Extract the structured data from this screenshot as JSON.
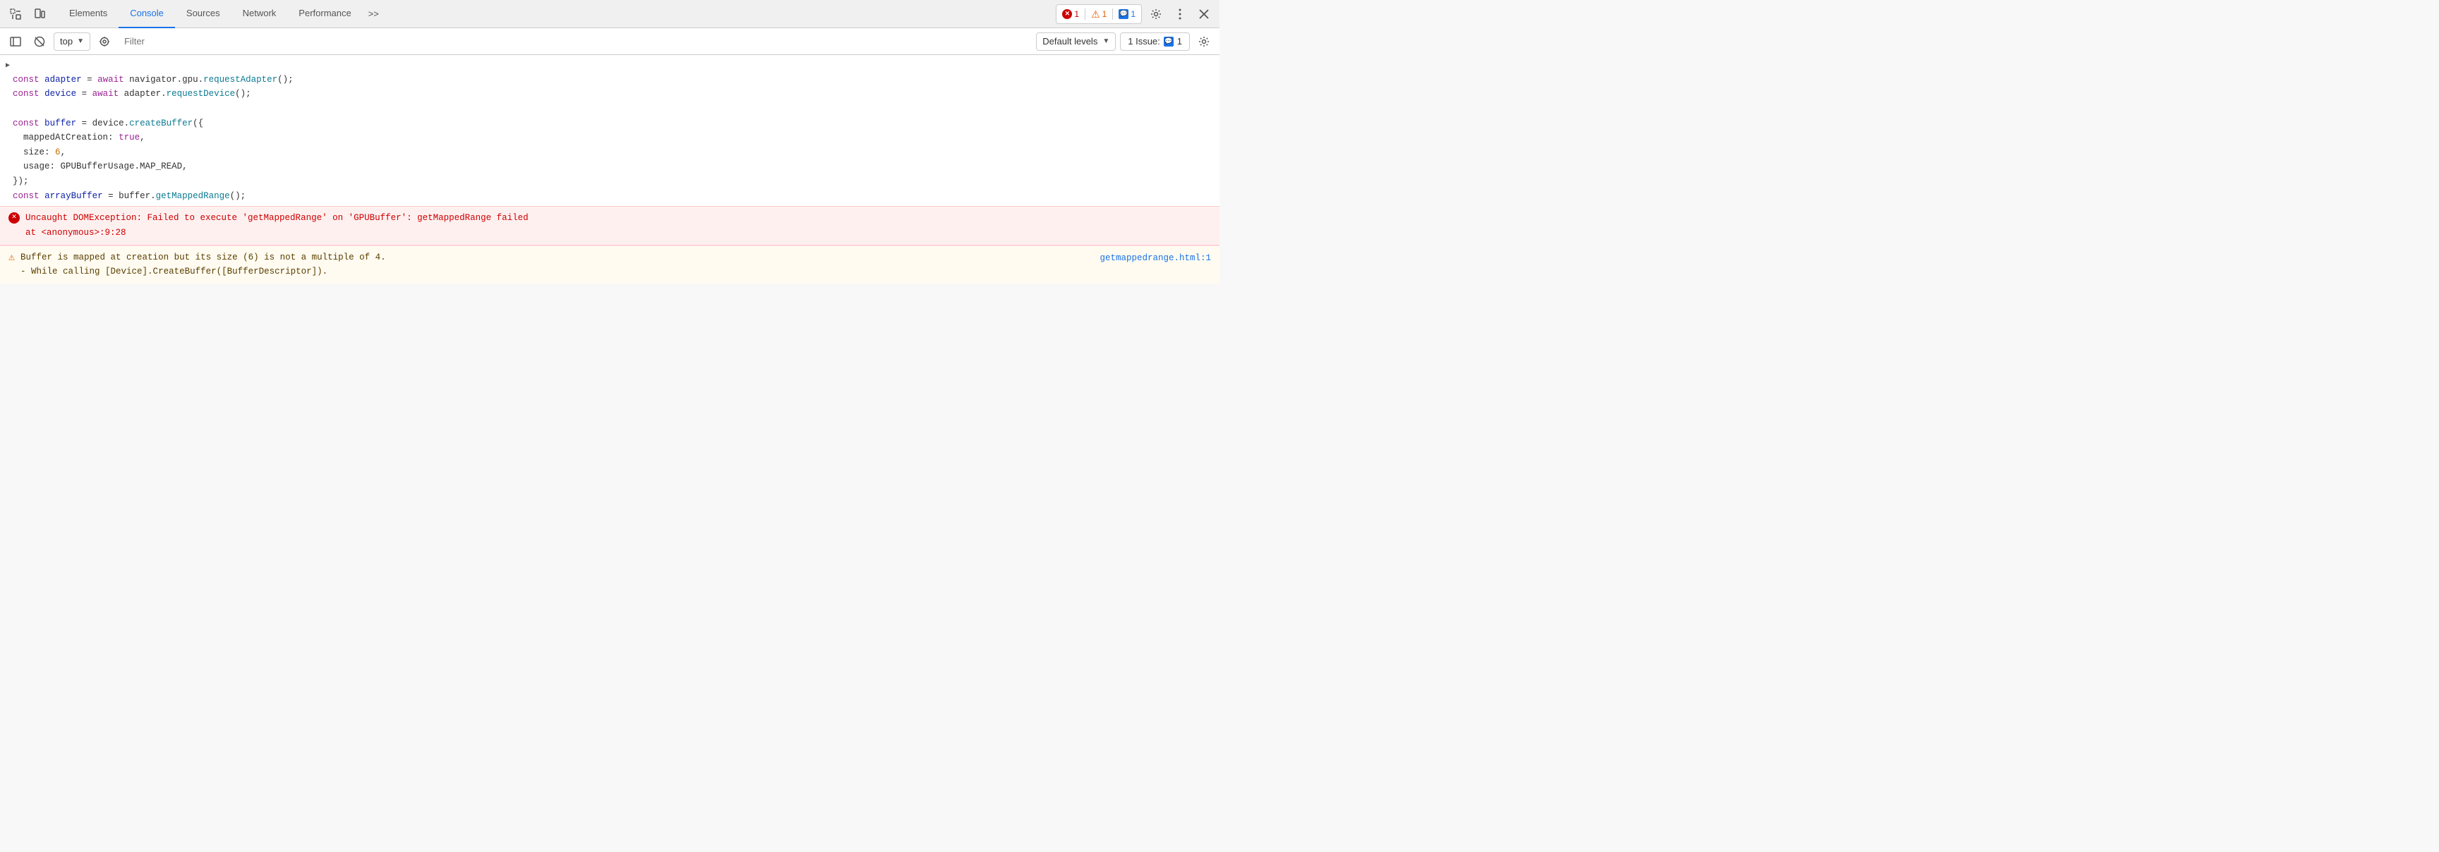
{
  "topbar": {
    "icons": {
      "inspect_label": "Inspect Element",
      "device_label": "Device Toolbar"
    },
    "tabs": [
      {
        "id": "elements",
        "label": "Elements",
        "active": false
      },
      {
        "id": "console",
        "label": "Console",
        "active": true
      },
      {
        "id": "sources",
        "label": "Sources",
        "active": false
      },
      {
        "id": "network",
        "label": "Network",
        "active": false
      },
      {
        "id": "performance",
        "label": "Performance",
        "active": false
      }
    ],
    "more_label": ">>",
    "error_count": "1",
    "warn_count": "1",
    "info_count": "1",
    "settings_label": "Settings",
    "more_options_label": "More options",
    "close_label": "Close"
  },
  "secondbar": {
    "sidebar_label": "Show sidebar",
    "clear_label": "Clear console",
    "top_selector": "top",
    "filter_placeholder": "Filter",
    "eye_label": "Live expressions",
    "default_levels_label": "Default levels",
    "issue_label": "1 Issue:",
    "issue_count": "1",
    "settings2_label": "Console settings"
  },
  "console": {
    "code_line1": "> const adapter = await navigator.gpu.requestAdapter();",
    "code_line2": "  const device = await adapter.requestDevice();",
    "code_line3": "",
    "code_line4": "  const buffer = device.createBuffer({",
    "code_line5": "    mappedAtCreation: true,",
    "code_line6": "    size: 6,",
    "code_line7": "    usage: GPUBufferUsage.MAP_READ,",
    "code_line8": "  });",
    "code_line9": "  const arrayBuffer = buffer.getMappedRange();",
    "error_message": "Uncaught DOMException: Failed to execute 'getMappedRange' on 'GPUBuffer': getMappedRange failed",
    "error_location": "    at <anonymous>:9:28",
    "warning_message": "▲ Buffer is mapped at creation but its size (6) is not a multiple of 4.",
    "warning_sub": "  - While calling [Device].CreateBuffer([BufferDescriptor]).",
    "warning_link": "getmappedrange.html:1"
  }
}
